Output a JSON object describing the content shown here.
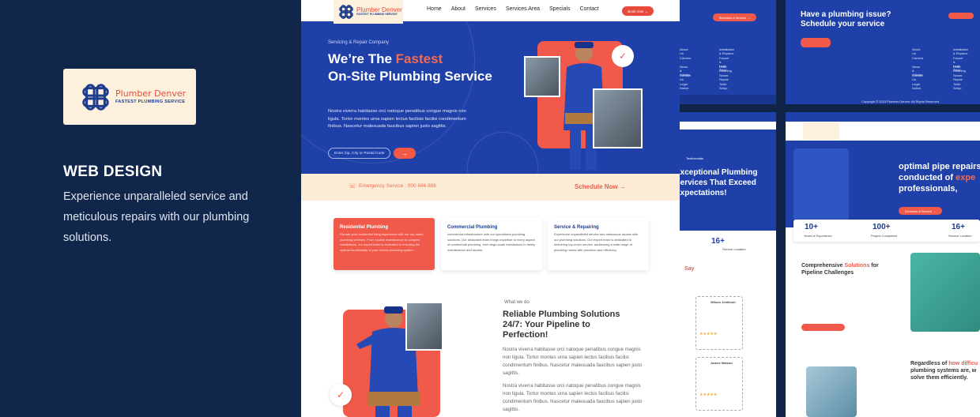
{
  "brand": {
    "name": "Plumber Denver",
    "tagline": "FASTEST PLUMBING SERVICE"
  },
  "intro": {
    "title": "WEB DESIGN",
    "description": "Experience unparalleled service and meticulous repairs with our plumbing solutions."
  },
  "nav": {
    "items": [
      "Home",
      "About",
      "Services",
      "Services Area",
      "Specials",
      "Contact"
    ],
    "cta": "Book now →"
  },
  "hero": {
    "eyebrow": "Servicing & Repair Company",
    "title_part1": "We’re The ",
    "title_accent": "Fastest",
    "title_part2": "On-Site Plumbing Service",
    "text": "Nostra viverra habitasse orci natoque penatibus congue magnis non ligula. Tortor montes urna sapien lectus facilisis facilisi condimentum finibus. Nascetur malesuada faucibus sapien justo sagittis.",
    "input_placeholder": "Enter Zip, City or Postal Code",
    "go": "→"
  },
  "emergency": {
    "label": "Emergency Service : 000 666 888",
    "cta": "Schedule Now →"
  },
  "services": [
    {
      "title": "Residential Plumbing",
      "text": "Elevate your residential living experience with our top-notch plumbing services. From routine maintenance to complex installations, our expert team is dedicated to ensuring the optimal functionality of your homes plumbing system."
    },
    {
      "title": "Commercial Plumbing",
      "text": "commercial infrastructure with our specialized plumbing solutions. Our dedicated team brings expertise to every aspect of commercial plumbing, from large-scale installations to timely maintenance and repairs."
    },
    {
      "title": "Service & Repairing",
      "text": "Experience unparalleled service and meticulous repairs with our plumbing solutions. Our expert team is dedicated to delivering top-notch service, addressing a wide range of plumbing needs with precision and efficiency."
    }
  ],
  "about": {
    "eyebrow": "What we do",
    "title": "Reliable Plumbing Solutions 24/7: Your Pipeline to Perfection!",
    "p1": "Nostra viverra habitasse orci natoque penatibus congue magnis non ligula. Tortor montes urna sapien lectus facilisis facilisi condimentum finibus. Nascetur malesuada faucibus sapien justo sagittis.",
    "p2": "Nostra viverra habitasse orci natoque penatibus congue magnis non ligula. Tortor montes urna sapien lectus facilisis facilisi condimentum finibus. Nascetur malesuada faucibus sapien justo sagittis."
  },
  "side": {
    "cta_title": "Have a plumbing issue? Schedule your service",
    "schedule": "Schedule A Service →",
    "footer_links": [
      "About Us",
      "Careers",
      "News & Articles",
      "Contact Us",
      "Legal Notice"
    ],
    "footer_links2": [
      "Installation & Replace",
      "Faucet & Leak Bend",
      "Drain Cleaning",
      "Sewer Repair",
      "Toilet Setup"
    ],
    "copyright": "Copyright © 2023 Plumber Denver. All Rights Reserved.",
    "testimonial_eyebrow": "Testimonials",
    "testimonial_title": "Exceptional Plumbing Services That Exceed Expectations!",
    "stat1": "16+",
    "stat1_label": "Service Location",
    "say": "Say",
    "reviewer1": "Wilson Jenkinon",
    "reviewer2": "James Watson",
    "repair_title_a": "optimal pipe repairs",
    "repair_title_b": "conducted of ",
    "repair_acc": "expe",
    "repair_title_c": "professionals,",
    "stats": [
      {
        "v": "10+",
        "l": "Years of Experience"
      },
      {
        "v": "100+",
        "l": "Project Completed"
      },
      {
        "v": "16+",
        "l": "Service Location"
      }
    ],
    "comp_title_a": "Comprehensive ",
    "comp_acc": "Solutions",
    "comp_title_b": " for Pipeline Challenges",
    "regard_a": "Regardless of ",
    "regard_acc": "how difficu",
    "regard_b": "plumbing systems are, w",
    "regard_c": "solve them efficiently."
  }
}
